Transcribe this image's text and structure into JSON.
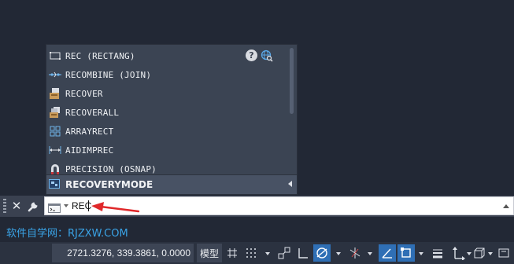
{
  "autocomplete": {
    "items": [
      {
        "label": "REC (RECTANG)",
        "icon": "rectangle-icon"
      },
      {
        "label": "RECOMBINE (JOIN)",
        "icon": "join-icon"
      },
      {
        "label": "RECOVER",
        "icon": "recover-icon"
      },
      {
        "label": "RECOVERALL",
        "icon": "recoverall-icon"
      },
      {
        "label": "ARRAYRECT",
        "icon": "array-rect-icon"
      },
      {
        "label": "AIDIMPREC",
        "icon": "dim-precision-icon"
      },
      {
        "label": "PRECISION (OSNAP)",
        "icon": "magnet-icon"
      }
    ],
    "selected": {
      "label": "RECOVERYMODE",
      "icon": "drawing-recovery-icon"
    },
    "help_symbol": "?"
  },
  "command_line": {
    "value": "REC",
    "close_symbol": "✕"
  },
  "watermark": "软件自学网：RJZXW.COM",
  "status_bar": {
    "coordinates": "2721.3276, 339.3861, 0.0000",
    "model_label": "模型"
  },
  "colors": {
    "background": "#222835",
    "popup": "#3b4453",
    "accent_blue": "#2f6fb5",
    "watermark": "#3aa3e6",
    "arrow_red": "#e0282a"
  }
}
